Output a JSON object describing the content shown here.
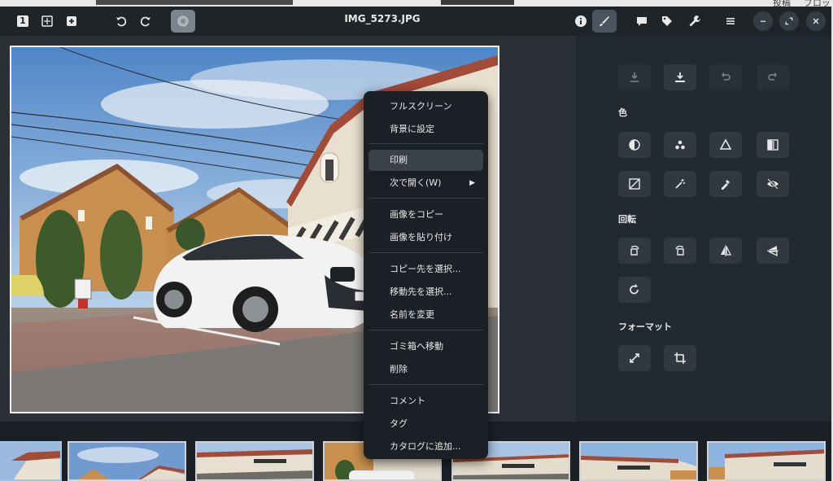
{
  "window": {
    "title": "IMG_5273.JPG"
  },
  "background_app": {
    "text1": "投稿",
    "text2": "ブロック"
  },
  "header": {
    "left_buttons": [
      {
        "name": "one-to-one-icon",
        "glyph": "1"
      },
      {
        "name": "fit-icon"
      },
      {
        "name": "zoom-in-icon"
      },
      {
        "name": "rotate-left-icon"
      },
      {
        "name": "rotate-right-icon"
      },
      {
        "name": "slideshow-icon"
      }
    ],
    "right_buttons": [
      "info-icon",
      "edit-brush-icon",
      "comment-icon",
      "tag-icon",
      "wrench-icon",
      "menu-icon",
      "minimize-icon",
      "maximize-icon",
      "close-icon"
    ]
  },
  "panel": {
    "section_color": "色",
    "section_rotate": "回転",
    "section_format": "フォーマット"
  },
  "context_menu": {
    "items": [
      {
        "label": "フルスクリーン"
      },
      {
        "label": "背景に設定"
      },
      {
        "label": "印刷",
        "highlighted": true
      },
      {
        "label": "次で開く(W)",
        "submenu": "▶"
      },
      {
        "label": "画像をコピー"
      },
      {
        "label": "画像を貼り付け"
      },
      {
        "label": "コピー先を選択..."
      },
      {
        "label": "移動先を選択..."
      },
      {
        "label": "名前を変更"
      },
      {
        "label": "ゴミ箱へ移動"
      },
      {
        "label": "削除"
      },
      {
        "label": "コメント"
      },
      {
        "label": "タグ"
      },
      {
        "label": "カタログに追加..."
      }
    ]
  },
  "filmstrip": {
    "selected_index": 0,
    "thumbnail_count": 7
  },
  "colors": {
    "accent_selected": "#9cc6e6",
    "panel_bg": "#232930",
    "header_bg": "#1f2428"
  }
}
